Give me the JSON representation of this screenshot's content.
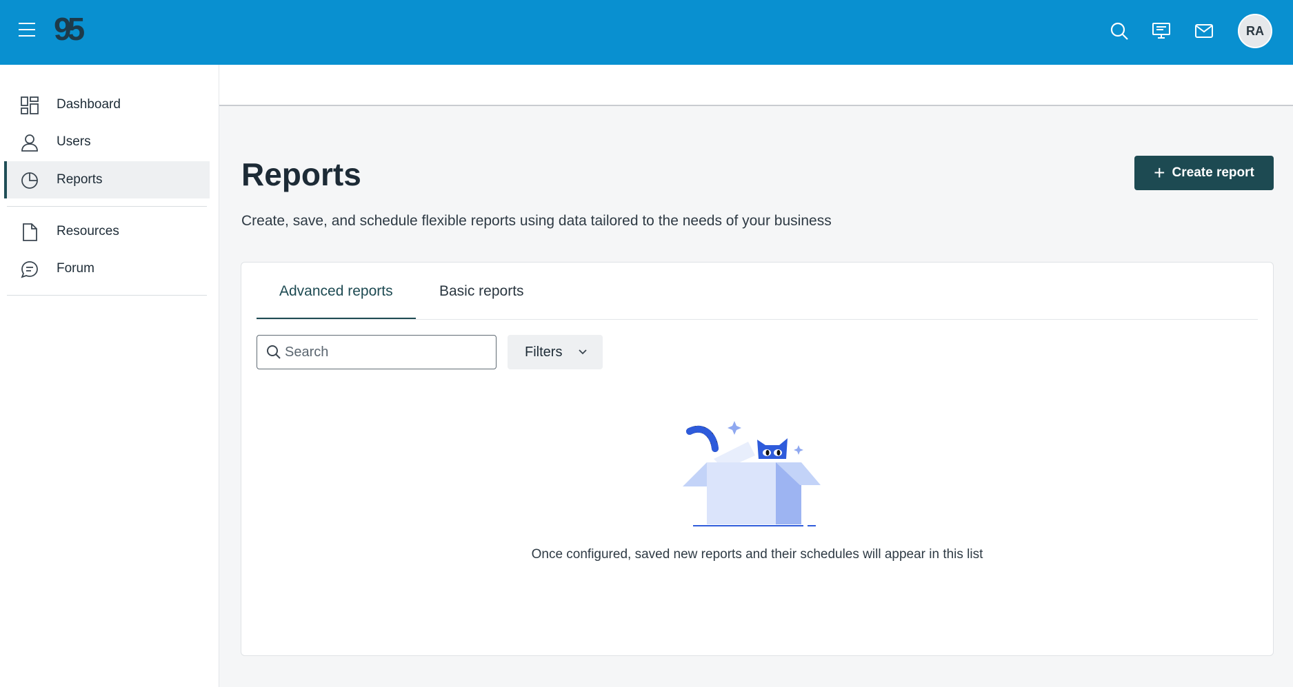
{
  "header": {
    "logo_text": "95",
    "avatar_initials": "RA",
    "icons": [
      "menu-icon",
      "search-icon",
      "presentation-icon",
      "mail-icon"
    ]
  },
  "sidebar": {
    "items": [
      {
        "label": "Dashboard",
        "icon": "dashboard-icon",
        "active": false
      },
      {
        "label": "Users",
        "icon": "user-icon",
        "active": false
      },
      {
        "label": "Reports",
        "icon": "pie-chart-icon",
        "active": true
      },
      {
        "label": "Resources",
        "icon": "document-icon",
        "active": false
      },
      {
        "label": "Forum",
        "icon": "chat-icon",
        "active": false
      }
    ]
  },
  "main": {
    "title": "Reports",
    "description": "Create, save, and schedule flexible reports using data tailored to the needs of your business",
    "create_button_label": "Create report",
    "tabs": [
      {
        "label": "Advanced reports",
        "active": true
      },
      {
        "label": "Basic reports",
        "active": false
      }
    ],
    "search": {
      "placeholder": "Search",
      "value": ""
    },
    "filters_label": "Filters",
    "empty_message": "Once configured, saved new reports and their schedules will appear in this list"
  },
  "colors": {
    "topbar": "#0990d0",
    "primary_button": "#1d4a52",
    "active_nav_border": "#1f4e56",
    "illustration_blue": "#2e5bdb"
  }
}
